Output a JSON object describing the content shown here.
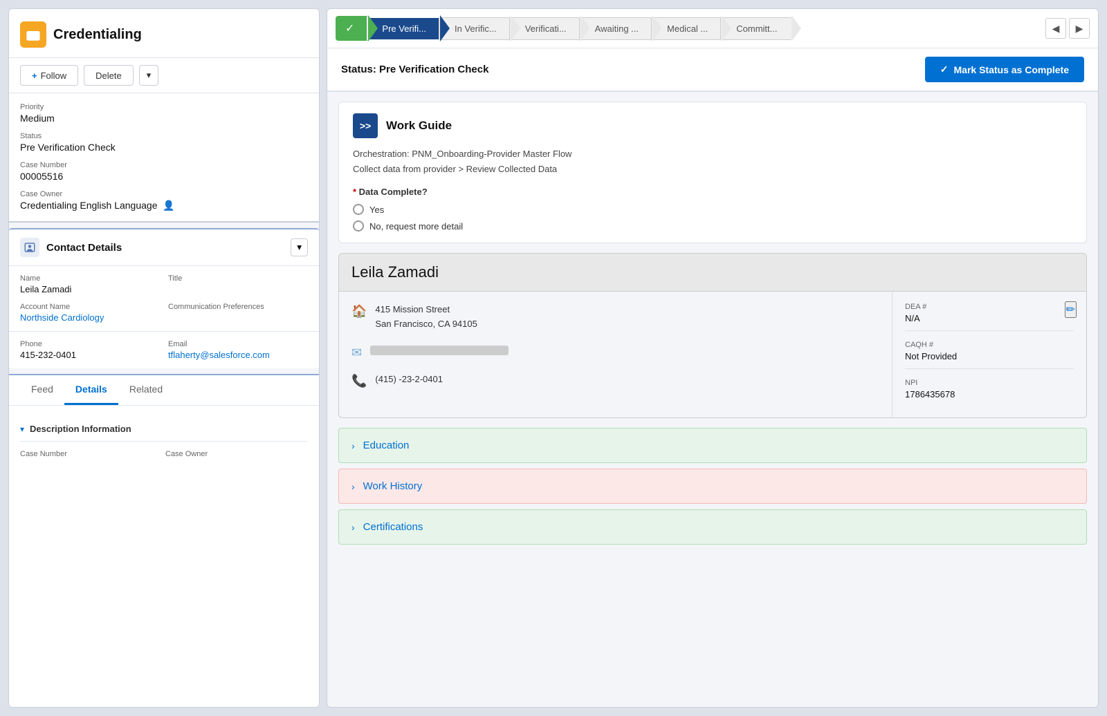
{
  "app": {
    "title": "Credentialing"
  },
  "left_actions": {
    "follow_label": "Follow",
    "delete_label": "Delete"
  },
  "fields": {
    "priority_label": "Priority",
    "priority_value": "Medium",
    "status_label": "Status",
    "status_value": "Pre Verification Check",
    "case_number_label": "Case Number",
    "case_number_value": "00005516",
    "case_owner_label": "Case Owner",
    "case_owner_value": "Credentialing English Language"
  },
  "contact_details": {
    "title": "Contact Details",
    "name_label": "Name",
    "name_value": "Leila Zamadi",
    "title_label": "Title",
    "title_value": "",
    "account_name_label": "Account Name",
    "account_name_value": "Northside Cardiology",
    "communication_label": "Communication Preferences",
    "communication_value": "",
    "phone_label": "Phone",
    "phone_value": "415-232-0401",
    "email_label": "Email",
    "email_value": "tflaherty@salesforce.com"
  },
  "tabs": {
    "feed_label": "Feed",
    "details_label": "Details",
    "related_label": "Related",
    "active_tab": "Details"
  },
  "description_section": {
    "title": "Description Information",
    "case_number_label": "Case Number",
    "case_owner_label": "Case Owner"
  },
  "progress_steps": [
    {
      "label": "✓",
      "text": "",
      "state": "done",
      "is_first": true
    },
    {
      "label": "Pre Verifi...",
      "state": "active",
      "is_first": false
    },
    {
      "label": "In Verific...",
      "state": "pending",
      "is_first": false
    },
    {
      "label": "Verificati...",
      "state": "pending",
      "is_first": false
    },
    {
      "label": "Awaiting ...",
      "state": "pending",
      "is_first": false
    },
    {
      "label": "Medical ...",
      "state": "pending",
      "is_first": false
    },
    {
      "label": "Committ...",
      "state": "pending",
      "is_first": false
    }
  ],
  "status_bar": {
    "label": "Status:",
    "status_value": "Pre Verification Check",
    "mark_complete_label": "Mark Status as Complete"
  },
  "work_guide": {
    "title": "Work Guide",
    "icon_text": ">>",
    "line1": "Orchestration: PNM_Onboarding-Provider Master Flow",
    "line2": "Collect data from provider > Review Collected Data",
    "data_complete_label": "Data Complete?",
    "yes_label": "Yes",
    "no_label": "No, request more detail"
  },
  "provider": {
    "name": "Leila Zamadi",
    "address_line1": "415 Mission Street",
    "address_line2": "San Francisco, CA 94105",
    "phone": "(415) -23-2-0401",
    "dea_label": "DEA #",
    "dea_value": "N/A",
    "caqh_label": "CAQH #",
    "caqh_value": "Not Provided",
    "npi_label": "NPI",
    "npi_value": "1786435678"
  },
  "accordion": {
    "education_label": "Education",
    "work_history_label": "Work History",
    "certifications_label": "Certifications"
  }
}
